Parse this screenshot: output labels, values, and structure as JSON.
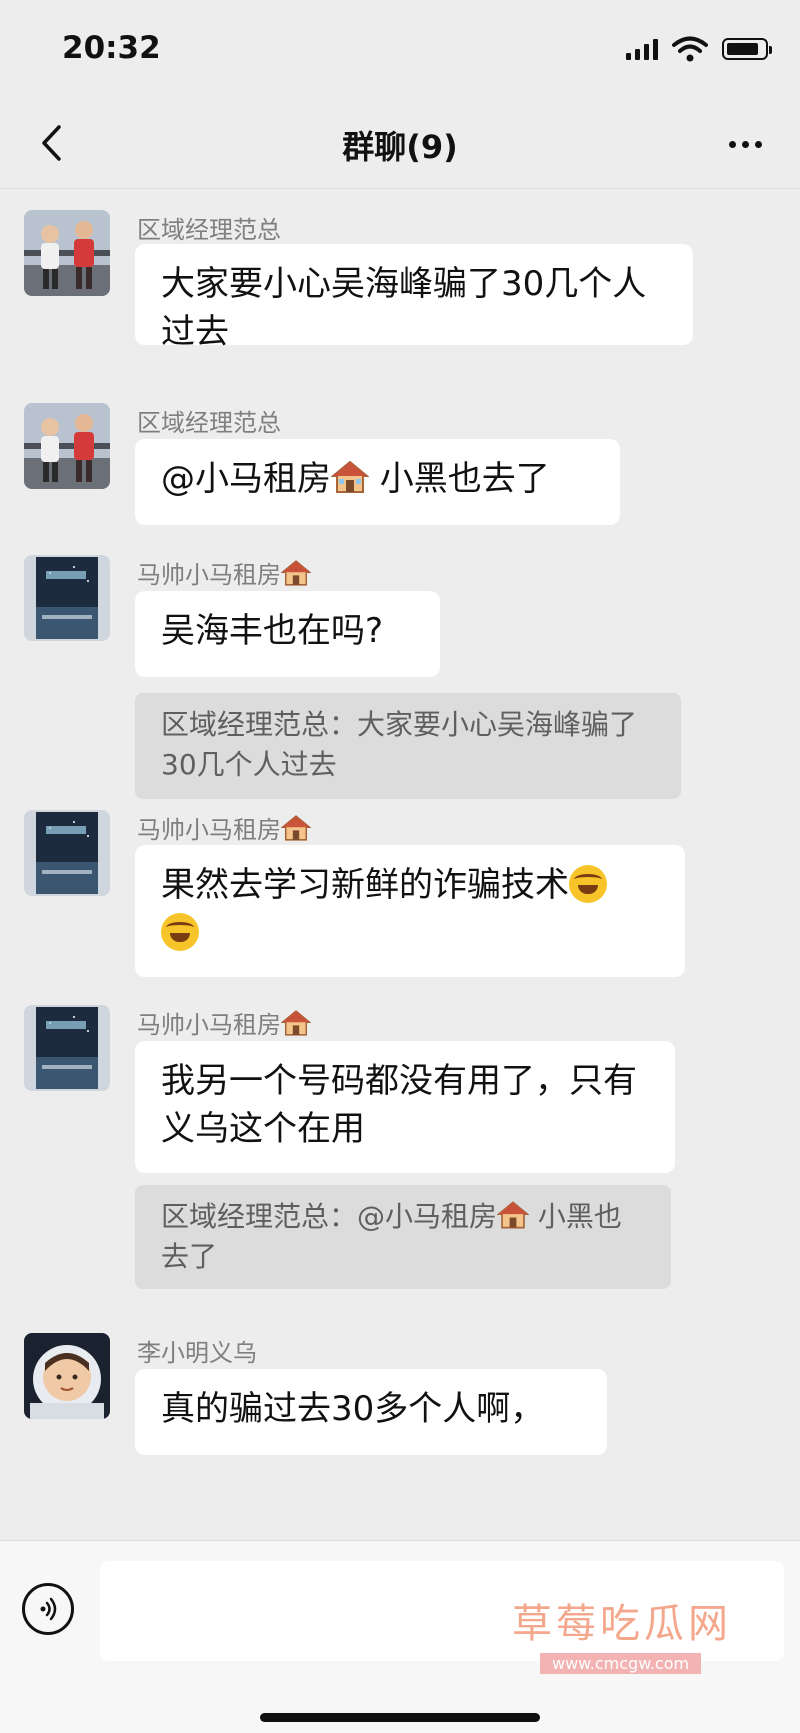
{
  "status": {
    "time": "20:32"
  },
  "header": {
    "title": "群聊(9)"
  },
  "messages": [
    {
      "sender": "区域经理范总",
      "text": "大家要小心吴海峰骗了30几个人过去"
    },
    {
      "sender": "区域经理范总",
      "text_before": "@小马租房",
      "text_after": " 小黑也去了"
    },
    {
      "sender": "马帅小马租房",
      "text": "吴海丰也在吗?",
      "quote": "区域经理范总：大家要小心吴海峰骗了30几个人过去"
    },
    {
      "sender": "马帅小马租房",
      "text": "果然去学习新鲜的诈骗技术"
    },
    {
      "sender": "马帅小马租房",
      "text": "我另一个号码都没有用了，只有义乌这个在用",
      "quote_before": "区域经理范总：@小马租房",
      "quote_after": " 小黑也去了"
    },
    {
      "sender": "李小明义乌",
      "text": "真的骗过去30多个人啊，"
    }
  ],
  "watermark": {
    "text": "草莓吃瓜网",
    "url": "www.cmcgw.com"
  },
  "icons": {
    "back": "chevron-left-icon",
    "more": "more-dots-icon",
    "voice": "voice-icon",
    "house": "house-emoji",
    "laugh": "laugh-cry-emoji"
  }
}
